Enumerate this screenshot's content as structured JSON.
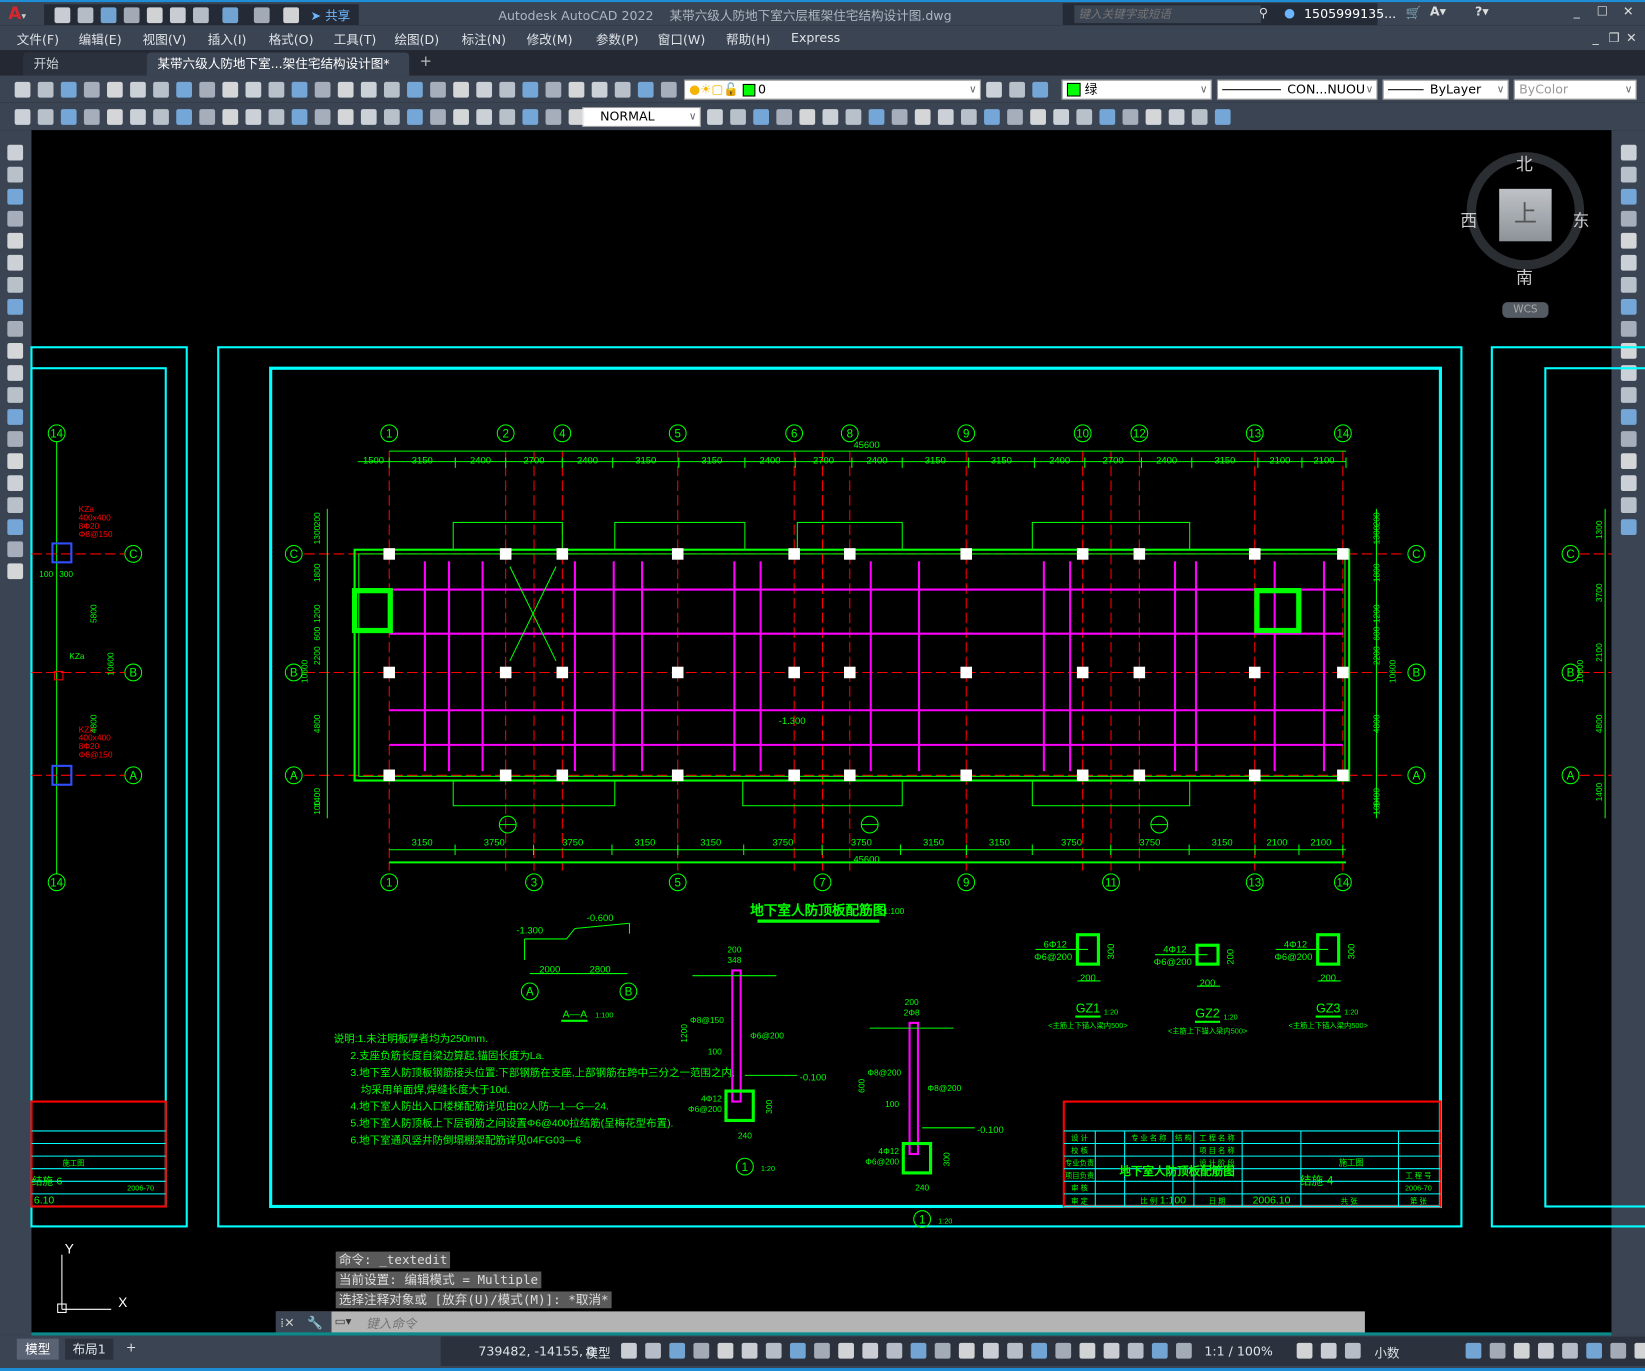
{
  "app": {
    "title": "Autodesk AutoCAD 2022",
    "file": "某带六级人防地下室六层框架住宅结构设计图.dwg",
    "share": "共享",
    "search_placeholder": "键入关键字或短语",
    "user": "1505999135...",
    "accent": "#1e8fd6"
  },
  "menu": [
    "文件(F)",
    "编辑(E)",
    "视图(V)",
    "插入(I)",
    "格式(O)",
    "工具(T)",
    "绘图(D)",
    "标注(N)",
    "修改(M)",
    "参数(P)",
    "窗口(W)",
    "帮助(H)",
    "Express"
  ],
  "tabs": [
    {
      "label": "开始"
    },
    {
      "label": "某带六级人防地下室...架住宅结构设计图*",
      "active": true
    }
  ],
  "props": {
    "layer": "0",
    "color": "绿",
    "color_hex": "#00ff00",
    "linetype": "CON...NUOU",
    "lineweight": "ByLayer",
    "plotstyle": "ByColor",
    "textstyle": "NORMAL"
  },
  "viewcube": {
    "north": "北",
    "south": "南",
    "east": "东",
    "west": "西",
    "top": "上",
    "wcs": "WCS"
  },
  "plan": {
    "title": "地下室人防顶板配筋图",
    "scale": "1:100",
    "top_axes": [
      "1",
      "2",
      "4",
      "5",
      "6",
      "8",
      "9",
      "10",
      "12",
      "13",
      "14"
    ],
    "bottom_axes": [
      "1",
      "3",
      "5",
      "7",
      "9",
      "11",
      "13",
      "14"
    ],
    "rows": [
      "C",
      "B",
      "A"
    ],
    "top_total": "45600",
    "top_dims": [
      1500,
      3150,
      2400,
      2700,
      2400,
      3150,
      3150,
      2400,
      2700,
      2400,
      3150,
      3150,
      2400,
      2700,
      2400,
      3150,
      2100,
      2100
    ],
    "bottom_dims": [
      3150,
      3750,
      3750,
      3150,
      3150,
      3750,
      3750,
      3150,
      3150,
      3750,
      3750,
      3150,
      2100,
      2100
    ],
    "bottom_total": "45600",
    "left_dims": [
      "1300",
      "1800",
      "1200",
      "600",
      "2200",
      "4800",
      "1400",
      "100",
      "200",
      "10600"
    ],
    "elev": "-1.300"
  },
  "section": {
    "title": "A—A",
    "scale": "1:100",
    "elev1": "-1.300",
    "elev2": "-0.600",
    "d1": "2000",
    "d2": "2800",
    "ax1": "A",
    "ax2": "B"
  },
  "details": [
    {
      "mark": "1",
      "scale": "1:20",
      "d_top": "200",
      "d_348": "348",
      "bar1": "Φ8@150",
      "bar2": "Φ6@200",
      "bars": "4Φ12",
      "stir": "Φ6@200",
      "w": "240",
      "h": "300",
      "elev": "-0.100",
      "d100": "100",
      "d1200": "1200"
    },
    {
      "mark": "1",
      "scale": "1:20",
      "d_top": "200",
      "d_348": "2Φ8",
      "bar1": "Φ8@200",
      "bar2": "Φ8@200",
      "bars": "4Φ12",
      "stir": "Φ6@200",
      "w": "240",
      "h": "300",
      "elev": "-0.100",
      "d100": "100",
      "d1200": "600"
    }
  ],
  "columns": [
    {
      "name": "GZ1",
      "scale": "1:20",
      "bars": "6Φ12",
      "stir": "Φ6@200",
      "w": "200",
      "h": "300",
      "note": "<主筋上下锚入梁内500>"
    },
    {
      "name": "GZ2",
      "scale": "1:20",
      "bars": "4Φ12",
      "stir": "Φ6@200",
      "w": "200",
      "h": "200",
      "note": "<主筋上下锚入梁内500>"
    },
    {
      "name": "GZ3",
      "scale": "1:20",
      "bars": "4Φ12",
      "stir": "Φ6@200",
      "w": "200",
      "h": "300",
      "note": "<主筋上下锚入梁内500>"
    }
  ],
  "notes": [
    "说明:1.未注明板厚者均为250mm.",
    "2.支座负筋长度自梁边算起,锚固长度为La.",
    "3.地下室人防顶板钢筋接头位置:下部钢筋在支座,上部钢筋在跨中三分之一范围之内,",
    "均采用单面焊,焊缝长度大于10d.",
    "4.地下室人防出入口楼梯配筋详见由02人防—1—G—24.",
    "5.地下室人防顶板上下层钢筋之间设置Φ6@400拉结筋(呈梅花型布置).",
    "6.地下室通风竖井防倒塌棚架配筋详见04FG03—6"
  ],
  "titleblock": {
    "rows": [
      "设 计",
      "校 核",
      "专业负责",
      "项目负责",
      "审 核",
      "审 定"
    ],
    "major_label": "专 业 名 称",
    "major": "结 构",
    "proj_label": "工 程 名 称",
    "item_label": "项 目 名 称",
    "phase_label": "设 计 阶 段",
    "phase": "施工图",
    "drawing": "地下室人防顶板配筋图",
    "sheet": "结施-4",
    "no_label": "工 程 号",
    "no": "2006-70",
    "scale_label": "比 例",
    "scale": "1:100",
    "date_label": "日 期",
    "date": "2006.10",
    "total_label": "共 张",
    "page_label": "第 张"
  },
  "left_partial": {
    "axis": "14",
    "kz1": [
      "KZa",
      "400x400",
      "8Φ20",
      "Φ8@150"
    ],
    "kz2": "KZa",
    "kz3": [
      "KZa",
      "400x400",
      "8Φ20",
      "Φ8@150"
    ],
    "dims": [
      "5800",
      "4800",
      "10600",
      "100",
      "300"
    ],
    "sheet": "结施-6",
    "phase": "施工图",
    "no": "2006-70",
    "date": "6.10"
  },
  "right_partial": {
    "dims": [
      "1300",
      "3700",
      "2100",
      "4800",
      "1400",
      "10600"
    ]
  },
  "command": {
    "history": [
      "命令: _textedit",
      "当前设置: 编辑模式 = Multiple",
      "选择注释对象或 [放弃(U)/模式(M)]: *取消*"
    ],
    "placeholder": "键入命令"
  },
  "status": {
    "tabs": [
      "模型",
      "布局1"
    ],
    "coords": "739482, -14155, 0",
    "space": "模型",
    "scale": "1:1 / 100%",
    "units": "小数"
  }
}
